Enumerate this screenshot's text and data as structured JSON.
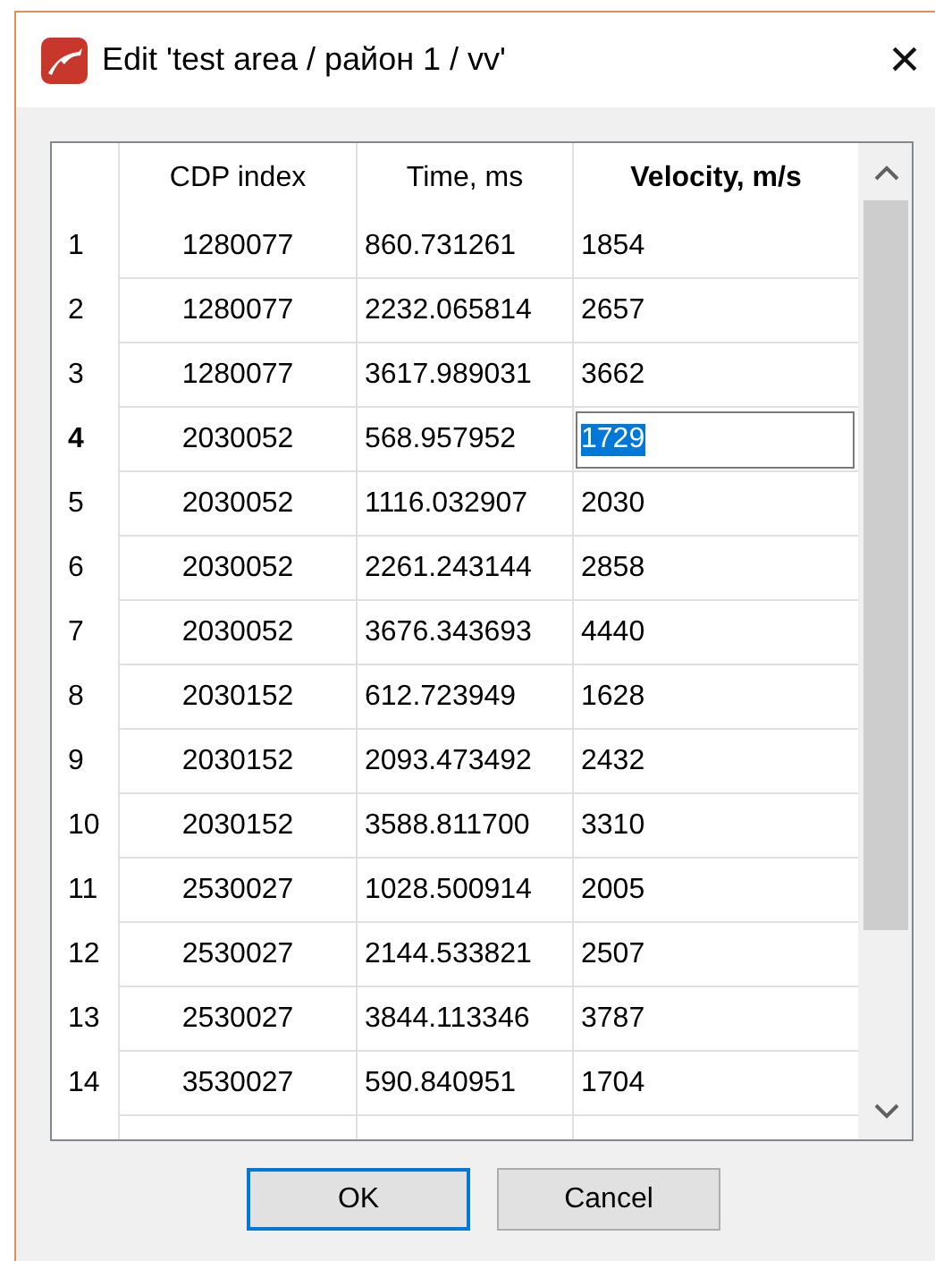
{
  "window": {
    "title": "Edit 'test area / район 1 / vv'",
    "close": "×"
  },
  "table": {
    "columns": [
      {
        "label": "CDP index",
        "bold": false
      },
      {
        "label": "Time, ms",
        "bold": false
      },
      {
        "label": "Velocity, m/s",
        "bold": true
      }
    ],
    "rows": [
      {
        "num": "1",
        "cdp": "1280077",
        "time": "860.731261",
        "velocity": "1854",
        "selected": false
      },
      {
        "num": "2",
        "cdp": "1280077",
        "time": "2232.065814",
        "velocity": "2657",
        "selected": false
      },
      {
        "num": "3",
        "cdp": "1280077",
        "time": "3617.989031",
        "velocity": "3662",
        "selected": false
      },
      {
        "num": "4",
        "cdp": "2030052",
        "time": "568.957952",
        "velocity": "1729",
        "selected": true
      },
      {
        "num": "5",
        "cdp": "2030052",
        "time": "1116.032907",
        "velocity": "2030",
        "selected": false
      },
      {
        "num": "6",
        "cdp": "2030052",
        "time": "2261.243144",
        "velocity": "2858",
        "selected": false
      },
      {
        "num": "7",
        "cdp": "2030052",
        "time": "3676.343693",
        "velocity": "4440",
        "selected": false
      },
      {
        "num": "8",
        "cdp": "2030152",
        "time": "612.723949",
        "velocity": "1628",
        "selected": false
      },
      {
        "num": "9",
        "cdp": "2030152",
        "time": "2093.473492",
        "velocity": "2432",
        "selected": false
      },
      {
        "num": "10",
        "cdp": "2030152",
        "time": "3588.811700",
        "velocity": "3310",
        "selected": false
      },
      {
        "num": "11",
        "cdp": "2530027",
        "time": "1028.500914",
        "velocity": "2005",
        "selected": false
      },
      {
        "num": "12",
        "cdp": "2530027",
        "time": "2144.533821",
        "velocity": "2507",
        "selected": false
      },
      {
        "num": "13",
        "cdp": "2530027",
        "time": "3844.113346",
        "velocity": "3787",
        "selected": false
      },
      {
        "num": "14",
        "cdp": "3530027",
        "time": "590.840951",
        "velocity": "1704",
        "selected": false
      }
    ]
  },
  "buttons": [
    {
      "label": "OK",
      "default": true
    },
    {
      "label": "Cancel",
      "default": false
    }
  ]
}
